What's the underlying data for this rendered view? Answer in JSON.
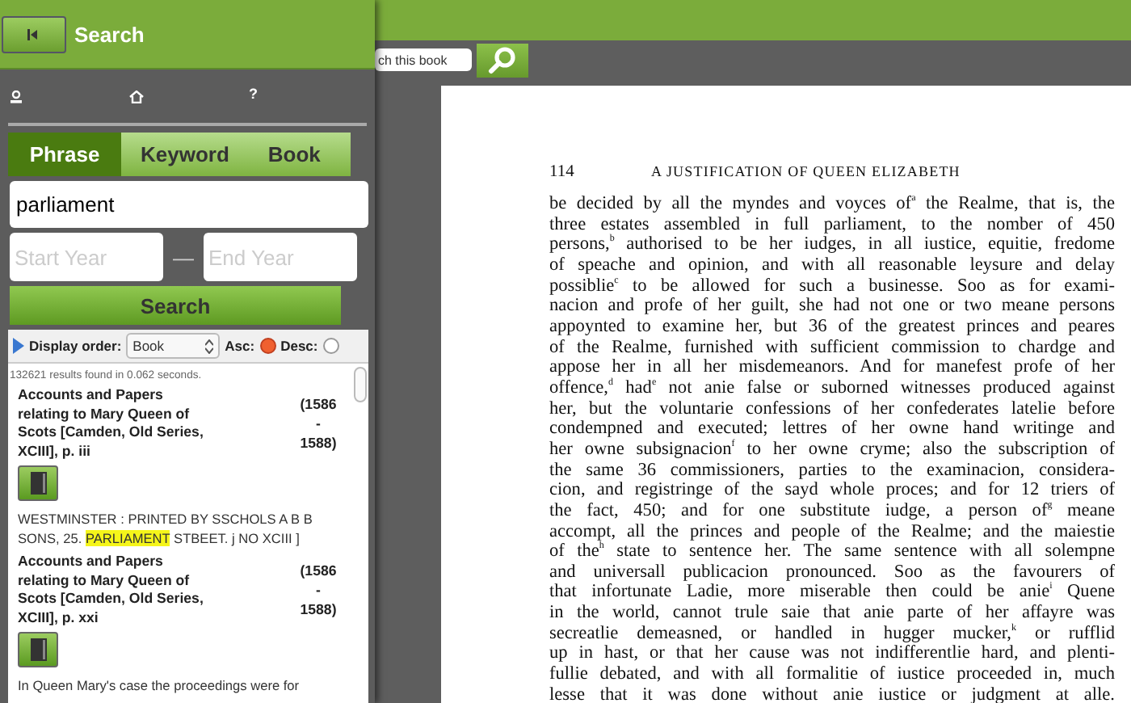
{
  "sidebar": {
    "title": "Search",
    "help": "?",
    "tabs": [
      {
        "label": "Phrase",
        "selected": true
      },
      {
        "label": "Keyword",
        "selected": false
      },
      {
        "label": "Book",
        "selected": false
      }
    ],
    "query": {
      "value": "parliament"
    },
    "start_year": {
      "placeholder": "Start Year"
    },
    "separator": "—",
    "end_year": {
      "placeholder": "End Year"
    },
    "search_button": "Search",
    "display_order": {
      "label": "Display order:",
      "value": "Book",
      "options": [
        {
          "label": "Asc:",
          "selected": true
        },
        {
          "label": "Desc:",
          "selected": false
        }
      ]
    },
    "result_count": "132621 results found in 0.062 seconds.",
    "results": [
      {
        "title": "Accounts and Papers relating to Mary Queen of Scots [Camden, Old Series, XCIII], p. iii",
        "date": "(1586 - 1588)",
        "snippet": {
          "before": "WESTMINSTER : PRINTED BY SSCHOLS A B B SONS, 25. ",
          "highlight": "PARLIAMENT",
          "after": " STBEET. j NO XCIII ]"
        }
      },
      {
        "title": "Accounts and Papers relating to Mary Queen of Scots [Camden, Old Series, XCIII], p. xxi",
        "date": "(1586 - 1588)",
        "snippet": {
          "before": "In Queen Mary's case the proceedings were for"
        }
      }
    ]
  },
  "book_search": {
    "placeholder": "ch this book"
  },
  "page": {
    "number": "114",
    "running_head": "A JUSTIFICATION OF QUEEN ELIZABETH",
    "lines": [
      "be decided by all the myndes and voyces of$^{a}$ the Realme, that is, the",
      "three estates assembled in full parliament, to the nomber of 450",
      "persons,$^{b}$ authorised to be her iudges, in all iustice, equitie, fredome",
      "of speache and opinion, and with all reasonable leysure and delay",
      "possiblie$^{c}$ to be allowed for such a businesse. Soo as for exami-",
      "nacion and profe of her guilt, she had not one or two meane persons",
      "appoynted to examine her, but 36 of the greatest princes and peares",
      "of the Realme, furnished with sufficient commission to chardge and",
      "appose her in all her misdemeanors. And for manefest profe of her",
      "offence,$^{d}$ had$^{e}$ not anie false or suborned witnesses produced against",
      "her, but the voluntarie confessions of her confederates latelie before",
      "condempned and executed; lettres of her owne hand writinge and",
      "her owne subsignacion$^{f}$ to her owne cryme; also the subscription of",
      "the same 36 commissioners, parties to the examinacion, considera-",
      "cion, and registringe of the sayd whole proces; and for 12 triers of",
      "the fact, 450; and for one substitute iudge, a person of$^{g}$ meane",
      "accompt, all the princes and people of the Realme; and the maiestie",
      "of the$^{h}$ state to sentence her. The same sentence with all solempne",
      "and universall publicacion pronounced. Soo as the favourers of",
      "that infortunate Ladie, more miserable then could be anie$^{i}$ Quene",
      "in the world, cannot trule saie that anie parte of her affayre was",
      "secreatlie demeasned, or handled in hugger mucker,$^{k}$ or rufflid",
      "up in hast, or that her cause was not indifferentlie hard, and plenti-",
      "fullie debated, and with all formalitie of iustice proceeded in, much",
      "lesse that it was done without anie iustice or judgment at alle."
    ]
  }
}
